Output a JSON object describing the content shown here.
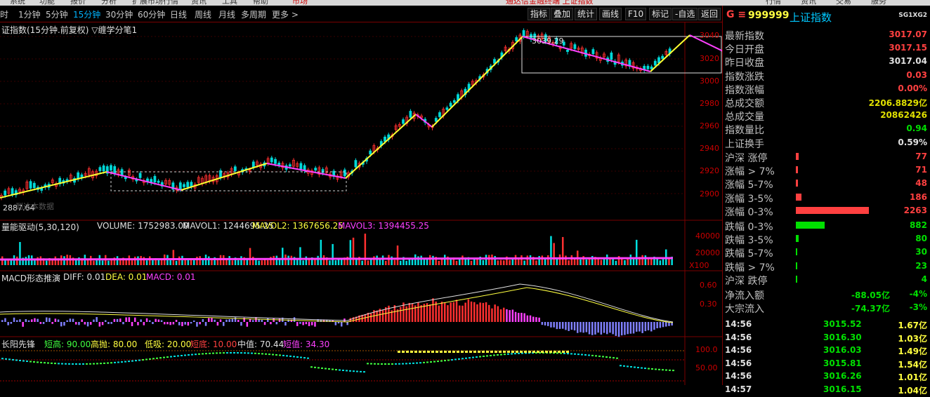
{
  "top_menu": [
    "系统",
    "功能",
    "报价",
    "分析",
    "扩展市场行情",
    "资讯",
    "工具",
    "帮助"
  ],
  "top_center": "市场",
  "top_banner": "通达信金融终端 上证指数",
  "top_right": [
    "行情",
    "资讯",
    "交易",
    "服务"
  ],
  "periods": [
    "时",
    "1分钟",
    "5分钟",
    "15分钟",
    "30分钟",
    "60分钟",
    "日线",
    "周线",
    "月线",
    "多周期",
    "更多 >"
  ],
  "active_period": "15分钟",
  "tool_tabs": [
    "指标",
    "叠加",
    "统计",
    "画线",
    "F10",
    "标记",
    "-自选",
    "返回"
  ],
  "chart": {
    "title": "证指数(15分钟.前复权) ▽缠学分笔1",
    "high_label": "3039.29",
    "low_label": "2887.64",
    "watermark": "到达本数据",
    "price_ticks": [
      "3040",
      "3020",
      "3000",
      "2980",
      "2960",
      "2940",
      "2920",
      "2900"
    ],
    "vol_header": {
      "name": "量能驱动(5,30,120)",
      "volume": "VOLUME: 1752983.00",
      "mavol1": "MAVOL1: 1244695.25",
      "mavol2": "MAVOL2: 1367656.25",
      "mavol3": "MAVOL3: 1394455.25"
    },
    "vol_ticks": [
      "40000",
      "20000",
      "X100"
    ],
    "macd_header": {
      "name": "MACD形态推演",
      "diff": "DIFF: 0.01",
      "dea": "DEA: 0.01",
      "macd": "MACD: 0.01"
    },
    "macd_ticks": [
      "0.60",
      "0.30"
    ],
    "cy_header": {
      "name": "长阳先锋",
      "a": "短高: 90.00",
      "b": "高抛: 80.00",
      "c": "低吸: 20.00",
      "d": "短底: 10.00",
      "e": "中值: 70.44",
      "f": "短值: 34.30"
    },
    "cy_ticks": [
      "100.0",
      "50.00"
    ]
  },
  "quote": {
    "code": "999999",
    "name": "上证指数",
    "tag": "SG1XG2",
    "rows": [
      {
        "k": "最新指数",
        "v": "3017.07",
        "c": "#ff4040"
      },
      {
        "k": "今日开盘",
        "v": "3017.15",
        "c": "#ff4040"
      },
      {
        "k": "昨日收盘",
        "v": "3017.04",
        "c": "#e0e0e0"
      },
      {
        "k": "指数涨跌",
        "v": "0.03",
        "c": "#ff4040"
      },
      {
        "k": "指数涨幅",
        "v": "0.00%",
        "c": "#ff4040"
      },
      {
        "k": "总成交额",
        "v": "2206.8829亿",
        "c": "#e0e000"
      },
      {
        "k": "总成交量",
        "v": "20862426",
        "c": "#e0e000"
      },
      {
        "k": "指数量比",
        "v": "0.94",
        "c": "#00e000"
      },
      {
        "k": "上证换手",
        "v": "0.59%",
        "c": "#e0e0e0"
      }
    ],
    "breadth": [
      {
        "k": "沪深 涨停",
        "v": "77",
        "c": "#ff4040",
        "w": 0.04
      },
      {
        "k": "涨幅 > 7%",
        "v": "71",
        "c": "#ff4040",
        "w": 0.03
      },
      {
        "k": "涨幅 5-7%",
        "v": "48",
        "c": "#ff4040",
        "w": 0.03
      },
      {
        "k": "涨幅 3-5%",
        "v": "186",
        "c": "#ff4040",
        "w": 0.08
      },
      {
        "k": "涨幅 0-3%",
        "v": "2263",
        "c": "#ff4040",
        "w": 1.0
      },
      {
        "k": "跌幅 0-3%",
        "v": "882",
        "c": "#00e000",
        "w": 0.39
      },
      {
        "k": "跌幅 3-5%",
        "v": "80",
        "c": "#00e000",
        "w": 0.04
      },
      {
        "k": "跌幅 5-7%",
        "v": "30",
        "c": "#00e000",
        "w": 0.01
      },
      {
        "k": "跌幅 > 7%",
        "v": "23",
        "c": "#00e000",
        "w": 0.01
      },
      {
        "k": "沪深 跌停",
        "v": "4",
        "c": "#00e000",
        "w": 0.0
      }
    ],
    "flows": [
      {
        "k": "净流入额",
        "v": "-88.05亿",
        "p": "-4%"
      },
      {
        "k": "大宗流入",
        "v": "-74.37亿",
        "p": "-3%"
      }
    ],
    "ticks": [
      {
        "t": "14:56",
        "p": "3015.52",
        "v": "1.67亿"
      },
      {
        "t": "14:56",
        "p": "3016.30",
        "v": "1.03亿"
      },
      {
        "t": "14:56",
        "p": "3016.03",
        "v": "1.49亿"
      },
      {
        "t": "14:56",
        "p": "3015.81",
        "v": "1.54亿"
      },
      {
        "t": "14:56",
        "p": "3016.26",
        "v": "1.01亿"
      },
      {
        "t": "14:57",
        "p": "3016.15",
        "v": "1.04亿"
      }
    ]
  }
}
